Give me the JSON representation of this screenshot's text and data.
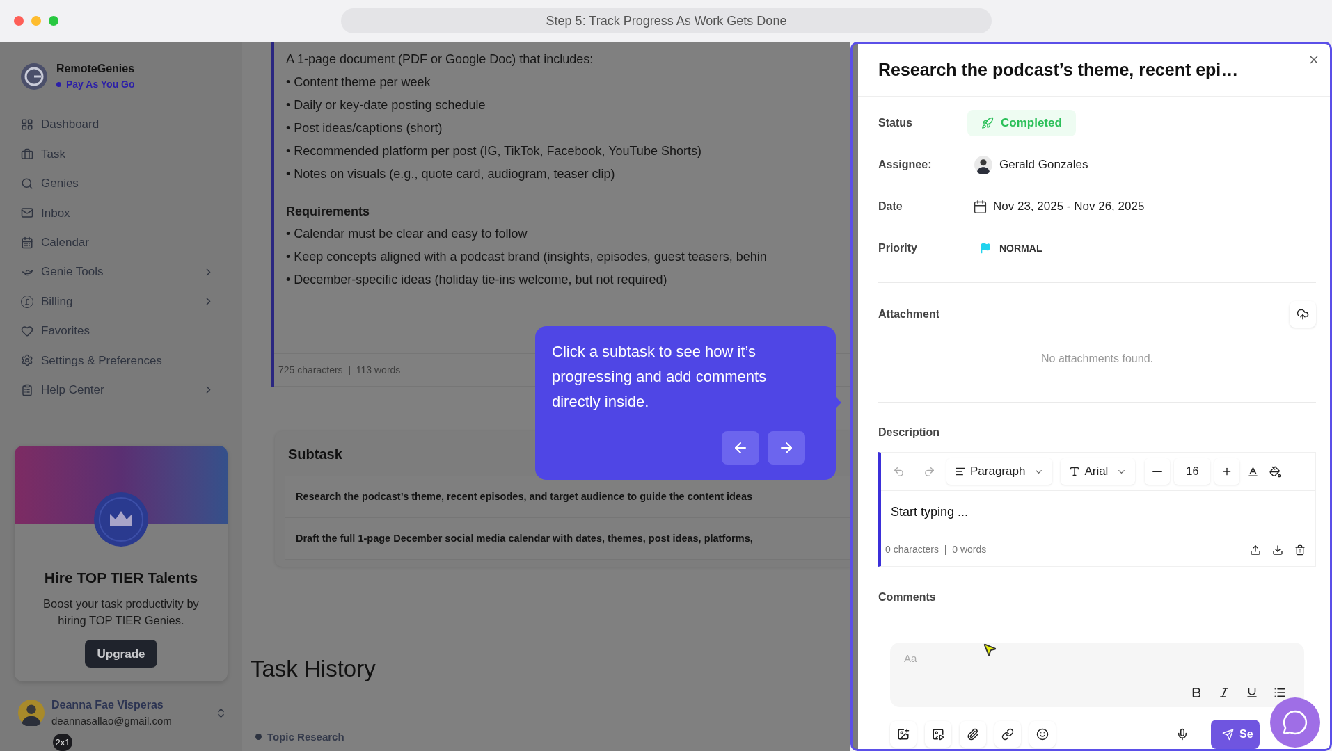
{
  "window": {
    "title": "Step 5: Track Progress As Work Gets Done"
  },
  "sidebar": {
    "brand": {
      "name": "RemoteGenies",
      "plan": "Pay As You Go"
    },
    "nav": [
      {
        "label": "Dashboard",
        "expandable": false
      },
      {
        "label": "Task",
        "expandable": false
      },
      {
        "label": "Genies",
        "expandable": false
      },
      {
        "label": "Inbox",
        "expandable": false
      },
      {
        "label": "Calendar",
        "expandable": false
      },
      {
        "label": "Genie Tools",
        "expandable": true
      },
      {
        "label": "Billing",
        "expandable": true
      },
      {
        "label": "Favorites",
        "expandable": false
      },
      {
        "label": "Settings & Preferences",
        "expandable": false
      },
      {
        "label": "Help Center",
        "expandable": true
      }
    ],
    "promo": {
      "title": "Hire TOP TIER Talents",
      "text": "Boost your task productivity by hiring TOP TIER Genies.",
      "button": "Upgrade"
    },
    "user": {
      "name": "Deanna Fae Visperas",
      "email": "deannasallao@gmail.com"
    },
    "zoom_badge": "2x1"
  },
  "main": {
    "description": {
      "lines": [
        {
          "kind": "text",
          "text": "A 1-page document (PDF or Google Doc) that includes:"
        },
        {
          "kind": "bullet",
          "text": "• Content theme per week"
        },
        {
          "kind": "bullet",
          "text": "• Daily or key-date posting schedule"
        },
        {
          "kind": "bullet",
          "text": "• Post ideas/captions (short)"
        },
        {
          "kind": "bullet",
          "text": "• Recommended platform per post (IG, TikTok, Facebook, YouTube Shorts)"
        },
        {
          "kind": "bullet",
          "text": "• Notes on visuals (e.g., quote card, audiogram, teaser clip)"
        },
        {
          "kind": "heading",
          "text": "Requirements"
        },
        {
          "kind": "bullet",
          "text": "• Calendar must be clear and easy to follow"
        },
        {
          "kind": "bullet",
          "text": "• Keep concepts aligned with a podcast brand (insights, episodes, guest teasers, behin"
        },
        {
          "kind": "bullet",
          "text": "• December-specific ideas (holiday tie-ins welcome, but not required)"
        }
      ],
      "stats": "725 characters  |  113 words"
    },
    "subtask": {
      "heading": "Subtask",
      "rows": [
        "Research the podcast’s theme, recent episodes, and target audience to guide the content ideas",
        "Draft the full 1-page December social media calendar with dates, themes, post ideas, platforms,"
      ]
    },
    "history": {
      "heading": "Task History",
      "items": [
        {
          "label": "Topic Research"
        }
      ]
    }
  },
  "tooltip": {
    "text": "Click a subtask to see how it’s progressing and add comments directly inside."
  },
  "panel": {
    "title": "Research the podcast’s theme, recent epi…",
    "fields": [
      {
        "label": "Status",
        "kind": "status",
        "value": "Completed"
      },
      {
        "label": "Assignee:",
        "kind": "person",
        "value": "Gerald Gonzales"
      },
      {
        "label": "Date",
        "kind": "date",
        "value": "Nov 23, 2025 - Nov 26, 2025"
      },
      {
        "label": "Priority",
        "kind": "priority",
        "value": "NORMAL"
      }
    ],
    "attachment": {
      "heading": "Attachment",
      "empty": "No attachments found."
    },
    "description": {
      "heading": "Description",
      "undo_disabled": true,
      "block_type": "Paragraph",
      "font": "Arial",
      "size": "16",
      "content": "Start typing ...",
      "stats": "0 characters  |  0 words"
    },
    "comments": {
      "heading": "Comments",
      "placeholder": "Aa",
      "send": "Se"
    }
  }
}
